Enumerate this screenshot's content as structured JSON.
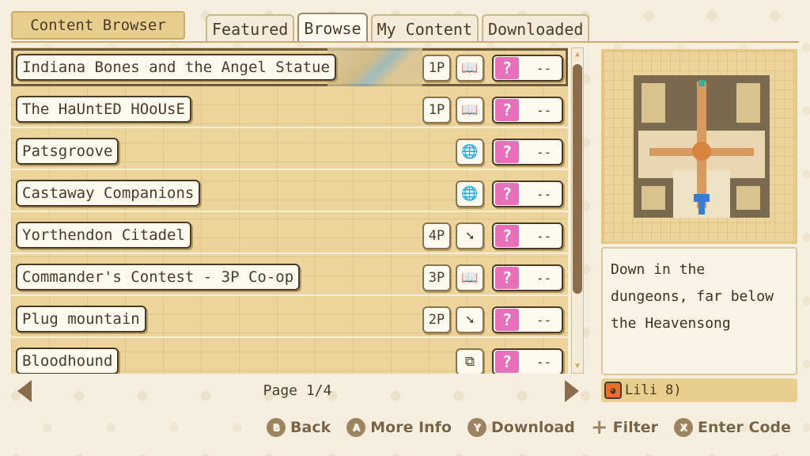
{
  "header": {
    "title": "Content Browser",
    "tabs": [
      "Featured",
      "Browse",
      "My Content",
      "Downloaded"
    ],
    "active_tab": "Browse"
  },
  "list": [
    {
      "title": "Indiana Bones and the Angel Statue",
      "players": "1P",
      "mode_icon": "book-icon",
      "rating": "--",
      "selected": true
    },
    {
      "title": "The HaUntED HOoUsE",
      "players": "1P",
      "mode_icon": "book-icon",
      "rating": "--"
    },
    {
      "title": "Patsgroove",
      "players": "",
      "mode_icon": "globe-icon",
      "rating": "--"
    },
    {
      "title": "Castaway Companions",
      "players": "",
      "mode_icon": "globe-icon",
      "rating": "--"
    },
    {
      "title": "Yorthendon Citadel",
      "players": "4P",
      "mode_icon": "sword-icon",
      "rating": "--"
    },
    {
      "title": "Commander's Contest - 3P Co-op",
      "players": "3P",
      "mode_icon": "book-icon",
      "rating": "--"
    },
    {
      "title": "Plug mountain",
      "players": "2P",
      "mode_icon": "sword-icon",
      "rating": "--"
    },
    {
      "title": "Bloodhound",
      "players": "",
      "mode_icon": "puzzle-icon",
      "rating": "--"
    }
  ],
  "rating_symbol": "?",
  "pager": {
    "label": "Page 1/4"
  },
  "detail": {
    "description": "Down in the dungeons, far below the Heavensong",
    "author": "Lili 8)"
  },
  "controls": [
    {
      "button": "B",
      "label": "Back"
    },
    {
      "button": "A",
      "label": "More Info"
    },
    {
      "button": "Y",
      "label": "Download"
    },
    {
      "button": "+",
      "label": "Filter"
    },
    {
      "button": "X",
      "label": "Enter Code"
    }
  ],
  "colors": {
    "accent": "#e8cf8e",
    "rating": "#e86fb9",
    "list_bg": "#ecd49a"
  }
}
